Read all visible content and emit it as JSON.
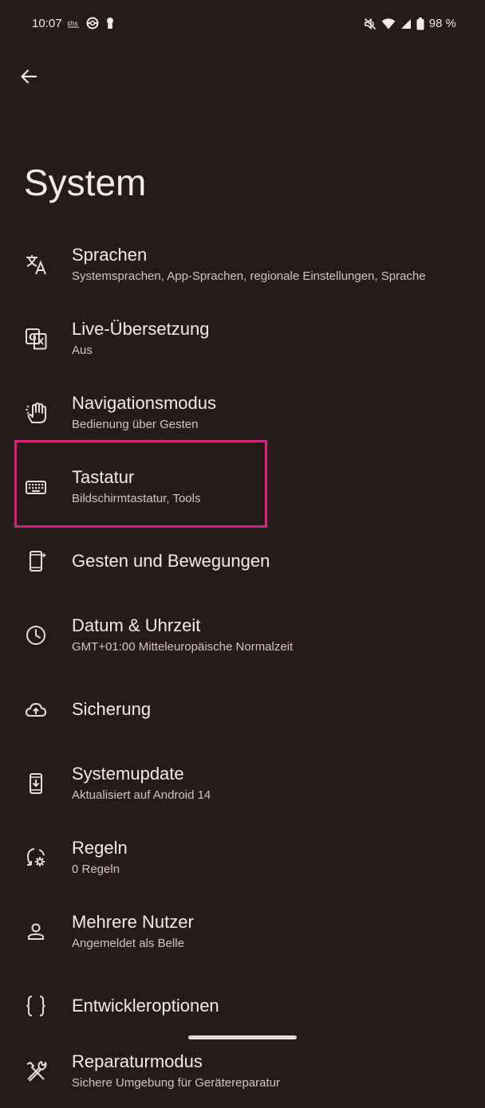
{
  "status_bar": {
    "time": "10:07",
    "battery": "98 %",
    "left_icons": [
      "notification-app-icon",
      "pokeball-icon",
      "keyhole-icon"
    ],
    "right_icons": [
      "mute-icon",
      "wifi-icon",
      "signal-icon",
      "battery-icon"
    ]
  },
  "header": {
    "back_icon": "arrow-back-icon",
    "title": "System"
  },
  "items": [
    {
      "title": "Sprachen",
      "subtitle": "Systemsprachen, App-Sprachen, regionale Einstellungen, Sprache",
      "icon": "translate-icon"
    },
    {
      "title": "Live-Übersetzung",
      "subtitle": "Aus",
      "icon": "live-translate-icon"
    },
    {
      "title": "Navigationsmodus",
      "subtitle": "Bedienung über Gesten",
      "icon": "gesture-hand-icon"
    },
    {
      "title": "Tastatur",
      "subtitle": "Bildschirmtastatur, Tools",
      "icon": "keyboard-icon"
    },
    {
      "title": "Gesten und Bewegungen",
      "subtitle": "",
      "icon": "phone-gesture-icon"
    },
    {
      "title": "Datum & Uhrzeit",
      "subtitle": "GMT+01:00 Mitteleuropäische Normalzeit",
      "icon": "clock-icon"
    },
    {
      "title": "Sicherung",
      "subtitle": "",
      "icon": "cloud-upload-icon"
    },
    {
      "title": "Systemupdate",
      "subtitle": "Aktualisiert auf Android 14",
      "icon": "system-update-icon"
    },
    {
      "title": "Regeln",
      "subtitle": "0 Regeln",
      "icon": "rules-icon"
    },
    {
      "title": "Mehrere Nutzer",
      "subtitle": "Angemeldet als Belle",
      "icon": "person-icon"
    },
    {
      "title": "Entwickleroptionen",
      "subtitle": "",
      "icon": "braces-icon"
    },
    {
      "title": "Reparaturmodus",
      "subtitle": "Sichere Umgebung für Gerätereparatur",
      "icon": "tools-icon"
    }
  ],
  "colors": {
    "background": "#251b19",
    "text_primary": "#f4ecea",
    "text_secondary": "#d6c5c0",
    "highlight": "#e0217f"
  }
}
